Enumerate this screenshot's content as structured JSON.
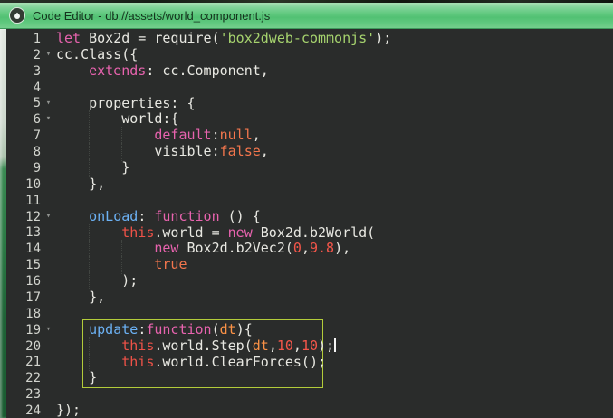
{
  "window": {
    "title": "Code Editor - db://assets/world_component.js",
    "icon": "water-drop-icon"
  },
  "editor": {
    "line_count": 24,
    "caret": {
      "line": 20,
      "position": "after-semicolon"
    },
    "annotation_box": {
      "lines": "19-22",
      "color": "#b3cc3a"
    },
    "palette": {
      "background": "#2a2c2b",
      "line_number": "#d2d4ce",
      "plain": "#e8e8e2",
      "keyword": "#e763ae",
      "function_name": "#6cb2f5",
      "string": "#a6d36e",
      "number": "#f4564a",
      "constant": "#f3764d",
      "this": "#ee5248",
      "param": "#fb9246",
      "titlebar_green": "#5ec87d"
    },
    "fold_icon": "▾",
    "lines": [
      {
        "n": 1,
        "fold": false,
        "caret": false,
        "segs": [
          [
            "keyword",
            "let"
          ],
          [
            "plain",
            " Box2d = require("
          ],
          [
            "string",
            "'box2dweb-commonjs'"
          ],
          [
            "plain",
            ");"
          ]
        ]
      },
      {
        "n": 2,
        "fold": true,
        "caret": false,
        "segs": [
          [
            "plain",
            "cc.Class({"
          ]
        ]
      },
      {
        "n": 3,
        "fold": false,
        "caret": false,
        "segs": [
          [
            "plain",
            "    "
          ],
          [
            "keyword",
            "extends"
          ],
          [
            "plain",
            ": cc.Component,"
          ]
        ]
      },
      {
        "n": 4,
        "fold": false,
        "caret": false,
        "segs": []
      },
      {
        "n": 5,
        "fold": true,
        "caret": false,
        "segs": [
          [
            "plain",
            "    properties: {"
          ]
        ]
      },
      {
        "n": 6,
        "fold": true,
        "caret": false,
        "segs": [
          [
            "plain",
            "        world:{"
          ]
        ]
      },
      {
        "n": 7,
        "fold": false,
        "caret": false,
        "segs": [
          [
            "plain",
            "            "
          ],
          [
            "keyword",
            "default"
          ],
          [
            "plain",
            ":"
          ],
          [
            "constant",
            "null"
          ],
          [
            "plain",
            ","
          ]
        ]
      },
      {
        "n": 8,
        "fold": false,
        "caret": false,
        "segs": [
          [
            "plain",
            "            visible:"
          ],
          [
            "constant",
            "false"
          ],
          [
            "plain",
            ","
          ]
        ]
      },
      {
        "n": 9,
        "fold": false,
        "caret": false,
        "segs": [
          [
            "plain",
            "        }"
          ]
        ]
      },
      {
        "n": 10,
        "fold": false,
        "caret": false,
        "segs": [
          [
            "plain",
            "    },"
          ]
        ]
      },
      {
        "n": 11,
        "fold": false,
        "caret": false,
        "segs": []
      },
      {
        "n": 12,
        "fold": true,
        "caret": false,
        "segs": [
          [
            "plain",
            "    "
          ],
          [
            "fname",
            "onLoad"
          ],
          [
            "plain",
            ": "
          ],
          [
            "keyword",
            "function"
          ],
          [
            "plain",
            " () {"
          ]
        ]
      },
      {
        "n": 13,
        "fold": false,
        "caret": false,
        "segs": [
          [
            "plain",
            "        "
          ],
          [
            "this",
            "this"
          ],
          [
            "plain",
            ".world = "
          ],
          [
            "keyword",
            "new"
          ],
          [
            "plain",
            " Box2d.b2World("
          ]
        ]
      },
      {
        "n": 14,
        "fold": false,
        "caret": false,
        "segs": [
          [
            "plain",
            "            "
          ],
          [
            "keyword",
            "new"
          ],
          [
            "plain",
            " Box2d.b2Vec2("
          ],
          [
            "number",
            "0"
          ],
          [
            "plain",
            ","
          ],
          [
            "number",
            "9.8"
          ],
          [
            "plain",
            "),"
          ]
        ]
      },
      {
        "n": 15,
        "fold": false,
        "caret": false,
        "segs": [
          [
            "plain",
            "            "
          ],
          [
            "constant",
            "true"
          ]
        ]
      },
      {
        "n": 16,
        "fold": false,
        "caret": false,
        "segs": [
          [
            "plain",
            "        );"
          ]
        ]
      },
      {
        "n": 17,
        "fold": false,
        "caret": false,
        "segs": [
          [
            "plain",
            "    },"
          ]
        ]
      },
      {
        "n": 18,
        "fold": false,
        "caret": false,
        "segs": []
      },
      {
        "n": 19,
        "fold": true,
        "caret": false,
        "segs": [
          [
            "plain",
            "    "
          ],
          [
            "fname",
            "update"
          ],
          [
            "plain",
            ":"
          ],
          [
            "keyword",
            "function"
          ],
          [
            "plain",
            "("
          ],
          [
            "param",
            "dt"
          ],
          [
            "plain",
            "){"
          ]
        ]
      },
      {
        "n": 20,
        "fold": false,
        "caret": true,
        "segs": [
          [
            "plain",
            "        "
          ],
          [
            "this",
            "this"
          ],
          [
            "plain",
            ".world.Step("
          ],
          [
            "param",
            "dt"
          ],
          [
            "plain",
            ","
          ],
          [
            "number",
            "10"
          ],
          [
            "plain",
            ","
          ],
          [
            "number",
            "10"
          ],
          [
            "plain",
            ");"
          ]
        ]
      },
      {
        "n": 21,
        "fold": false,
        "caret": false,
        "segs": [
          [
            "plain",
            "        "
          ],
          [
            "this",
            "this"
          ],
          [
            "plain",
            ".world.ClearForces();"
          ]
        ]
      },
      {
        "n": 22,
        "fold": false,
        "caret": false,
        "segs": [
          [
            "plain",
            "    }"
          ]
        ]
      },
      {
        "n": 23,
        "fold": false,
        "caret": false,
        "segs": []
      },
      {
        "n": 24,
        "fold": false,
        "caret": false,
        "segs": [
          [
            "plain",
            "});"
          ]
        ]
      }
    ]
  }
}
